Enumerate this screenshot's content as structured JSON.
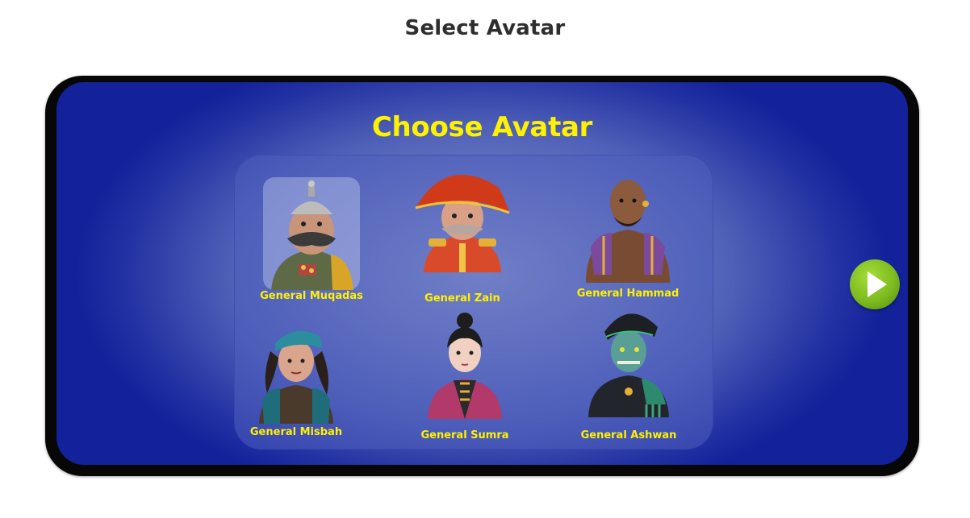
{
  "page": {
    "title": "Select Avatar"
  },
  "game": {
    "heading": "Choose Avatar",
    "selected_index": 0,
    "avatars": [
      {
        "name": "General Muqadas",
        "icon": "general-muqadas-portrait-icon"
      },
      {
        "name": "General Zain",
        "icon": "general-zain-portrait-icon"
      },
      {
        "name": "General Hammad",
        "icon": "general-hammad-portrait-icon"
      },
      {
        "name": "General Misbah",
        "icon": "general-misbah-portrait-icon"
      },
      {
        "name": "General Sumra",
        "icon": "general-sumra-portrait-icon"
      },
      {
        "name": "General Ashwan",
        "icon": "general-ashwan-portrait-icon"
      }
    ],
    "next_icon": "play-icon"
  },
  "colors": {
    "title_yellow": "#fff200",
    "screen_blue": "#13219a",
    "next_green": "#7dbb1f",
    "device_frame": "#070707"
  }
}
